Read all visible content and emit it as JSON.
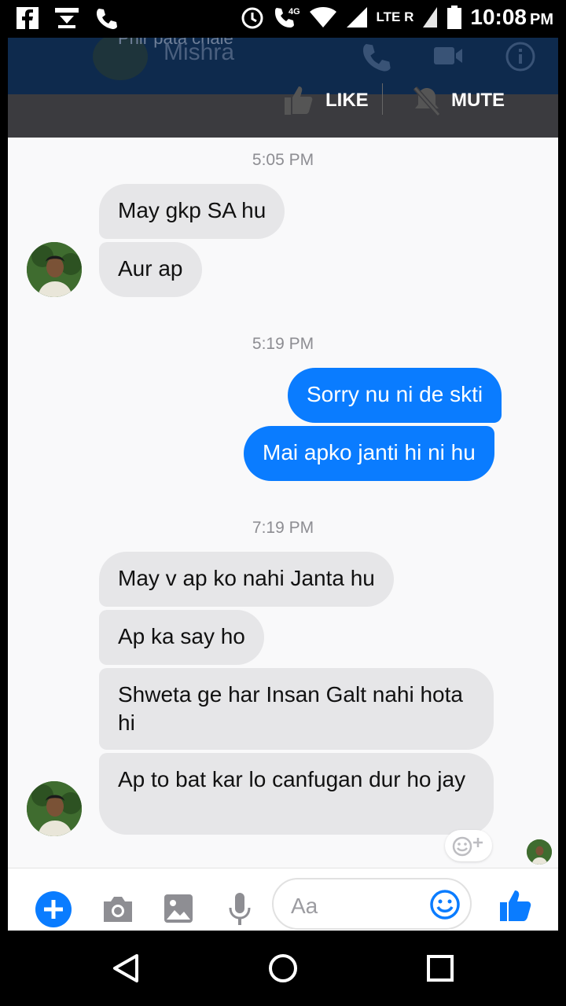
{
  "header": {
    "name": "Mishra",
    "subtitle": "Phir pata chale",
    "like_label": "LIKE",
    "mute_label": "MUTE"
  },
  "status_bar": {
    "time": "10:08",
    "ampm": "PM",
    "network": "4G",
    "lte": "LTE R"
  },
  "messages": {
    "t1": "5:05 PM",
    "m1": "May gkp SA hu",
    "m2": "Aur ap",
    "t2": "5:19 PM",
    "m3": "Sorry nu ni de skti",
    "m4": "Mai apko janti hi ni hu",
    "t3": "7:19 PM",
    "m5": "May v ap ko nahi Janta hu",
    "m6": "Ap ka say ho",
    "m7": "Shweta ge har Insan Galt nahi hota hi",
    "m8": "Ap to bat kar lo canfugan dur ho jay"
  },
  "composer": {
    "placeholder": "Aa"
  },
  "colors": {
    "accent": "#0a7cff",
    "incoming": "#e6e6e8",
    "header": "#0e2a4d"
  },
  "icons": [
    "facebook-icon",
    "notification-icon",
    "phone-icon",
    "alarm-icon",
    "wifi-call-icon",
    "wifi-icon",
    "signal-icon",
    "battery-icon",
    "thumbs-up-icon",
    "bell-off-icon",
    "plus-icon",
    "camera-icon",
    "image-icon",
    "mic-icon",
    "emoji-icon",
    "back-icon",
    "home-icon",
    "recents-icon"
  ]
}
